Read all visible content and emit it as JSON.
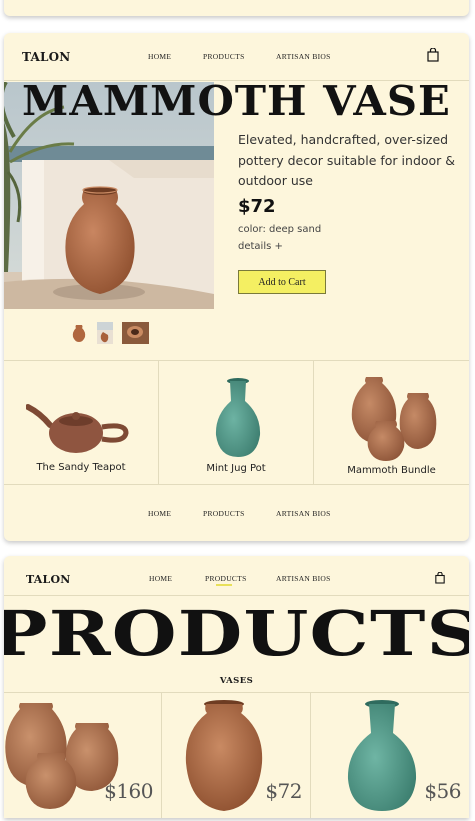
{
  "brand": {
    "logo": "TALON"
  },
  "nav": {
    "home": "HOME",
    "products": "PRODUCTS",
    "artisan": "ARTISAN BIOS"
  },
  "product": {
    "title": "MAMMOTH VASE",
    "description": "Elevated, handcrafted, over-sized pottery decor suitable for indoor & outdoor use",
    "price": "$72",
    "color": "color: deep sand",
    "details": "details +",
    "add_to_cart": "Add to Cart"
  },
  "related": [
    {
      "label": "The Sandy Teapot",
      "icon": "teapot-image"
    },
    {
      "label": "Mint Jug Pot",
      "icon": "green-vase-image"
    },
    {
      "label": "Mammoth Bundle",
      "icon": "vase-bundle-image"
    }
  ],
  "products_page": {
    "title": "PRODUCTS",
    "section": "VASES",
    "items": [
      {
        "price": "$160",
        "icon": "vase-bundle-image"
      },
      {
        "price": "$72",
        "icon": "terracotta-vase-image"
      },
      {
        "price": "$56",
        "icon": "green-vase-image"
      }
    ]
  },
  "colors": {
    "background": "#fdf6dc",
    "accent": "#f4ef62",
    "terracotta": "#b86e47",
    "mint": "#4e9a8a"
  }
}
